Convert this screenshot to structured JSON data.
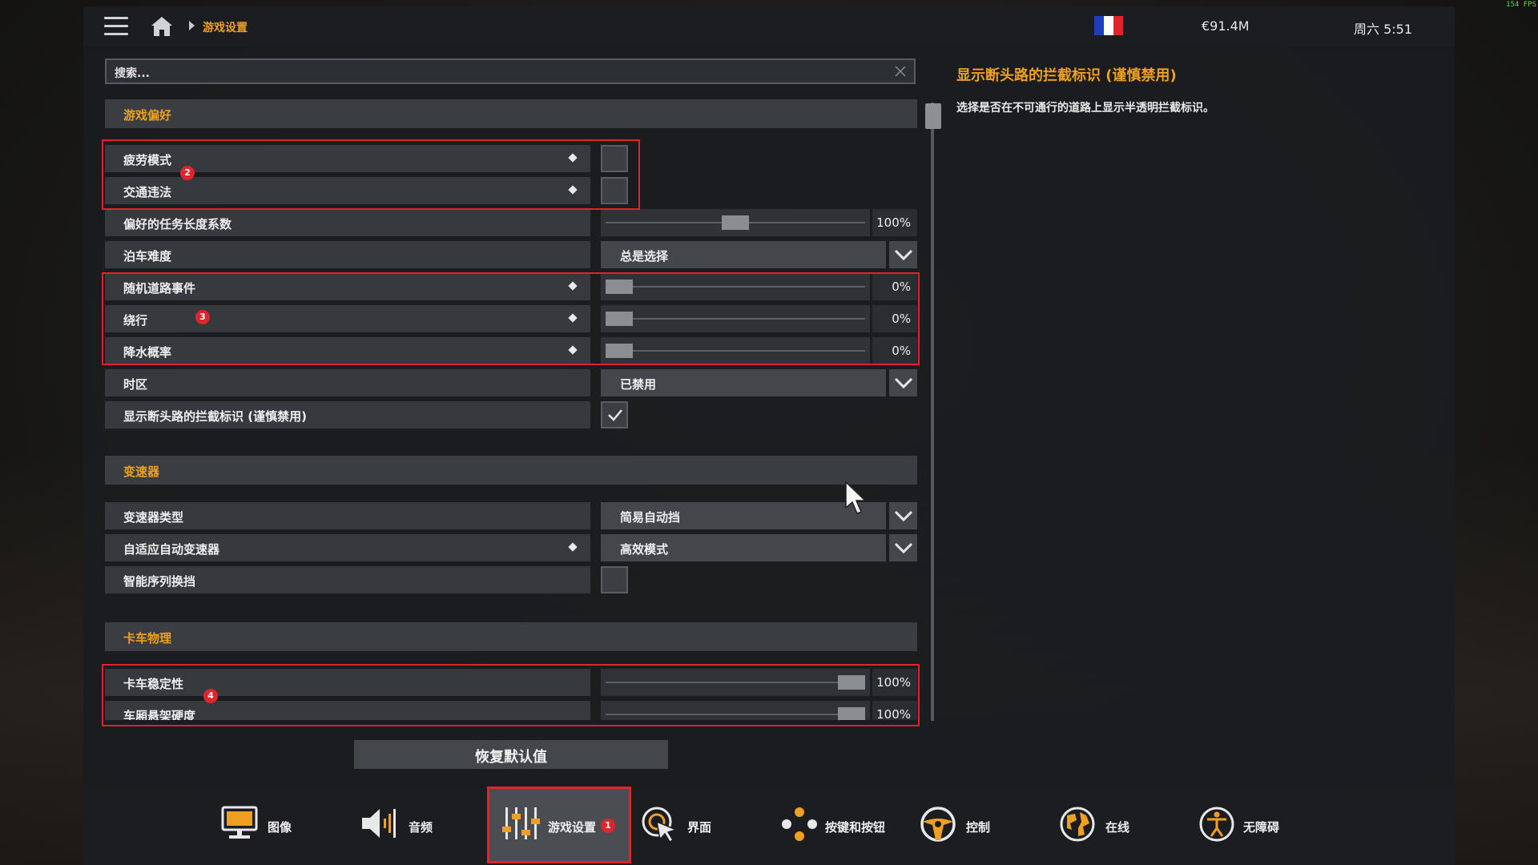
{
  "fps": "154 FPS",
  "breadcrumb": "游戏设置",
  "money": "€91.4M",
  "clock": "周六 5:51",
  "flag_colors": [
    "#1d3fbf",
    "#ffffff",
    "#e0242c"
  ],
  "search": {
    "placeholder": "搜索..."
  },
  "sections": {
    "prefs": "游戏偏好",
    "transmission": "变速器",
    "physics": "卡车物理"
  },
  "rows": {
    "fatigue": "疲劳模式",
    "traffic_offense": "交通违法",
    "job_length": "偏好的任务长度系数",
    "job_length_value": "100%",
    "parking": "泊车难度",
    "parking_value": "总是选择",
    "random_events": "随机道路事件",
    "random_events_value": "0%",
    "detours": "绕行",
    "detours_value": "0%",
    "rain": "降水概率",
    "rain_value": "0%",
    "timezone": "时区",
    "timezone_value": "已禁用",
    "dead_end": "显示断头路的拦截标识 (谨慎禁用)",
    "trans_type": "变速器类型",
    "trans_type_value": "简易自动挡",
    "adaptive": "自适应自动变速器",
    "adaptive_value": "高效模式",
    "smart_seq": "智能序列换挡",
    "stability": "卡车稳定性",
    "stability_value": "100%",
    "cabin_susp": "车厢悬架硬度",
    "cabin_susp_value": "100%"
  },
  "slider_levels": {
    "job_length": 0.5,
    "random_events": 0,
    "detours": 0,
    "rain": 0,
    "stability": 1.0,
    "cabin_susp": 1.0
  },
  "checkboxes": {
    "fatigue": false,
    "traffic_offense": false,
    "dead_end": true,
    "smart_seq": false
  },
  "badges": [
    "2",
    "3",
    "4",
    "1"
  ],
  "reset_label": "恢复默认值",
  "help": {
    "title": "显示断头路的拦截标识 (谨慎禁用)",
    "body": "选择是否在不可通行的道路上显示半透明拦截标识。"
  },
  "nav": {
    "graphics": "图像",
    "audio": "音频",
    "gameplay": "游戏设置",
    "interface": "界面",
    "keys": "按键和按钮",
    "controls": "控制",
    "online": "在线",
    "accessibility": "无障碍"
  }
}
